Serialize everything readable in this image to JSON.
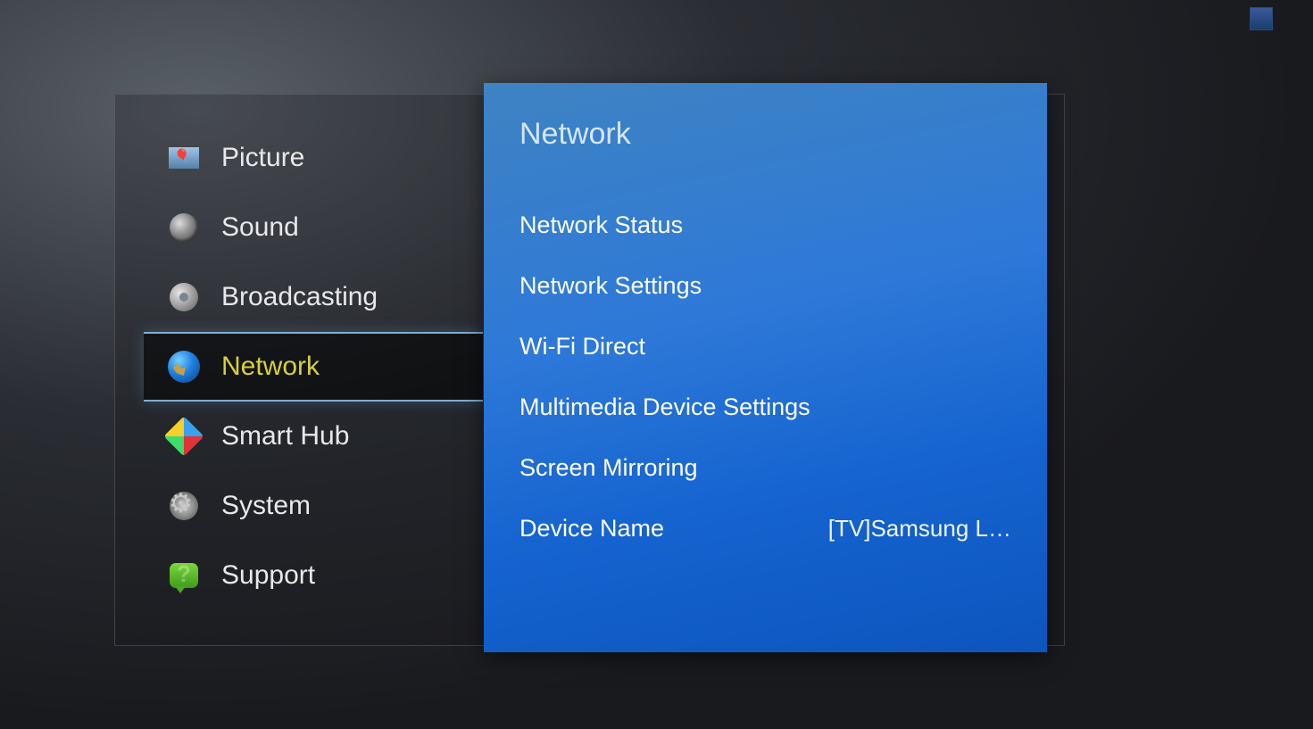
{
  "sidebar": {
    "items": [
      {
        "label": "Picture",
        "icon": "picture-icon"
      },
      {
        "label": "Sound",
        "icon": "sound-icon"
      },
      {
        "label": "Broadcasting",
        "icon": "broadcasting-icon"
      },
      {
        "label": "Network",
        "icon": "network-icon",
        "selected": true
      },
      {
        "label": "Smart Hub",
        "icon": "smarthub-icon"
      },
      {
        "label": "System",
        "icon": "system-icon"
      },
      {
        "label": "Support",
        "icon": "support-icon"
      }
    ]
  },
  "panel": {
    "title": "Network",
    "items": [
      {
        "label": "Network Status",
        "value": ""
      },
      {
        "label": "Network Settings",
        "value": ""
      },
      {
        "label": "Wi-Fi Direct",
        "value": ""
      },
      {
        "label": "Multimedia Device Settings",
        "value": ""
      },
      {
        "label": "Screen Mirroring",
        "value": ""
      },
      {
        "label": "Device Name",
        "value": "[TV]Samsung L…"
      }
    ]
  }
}
